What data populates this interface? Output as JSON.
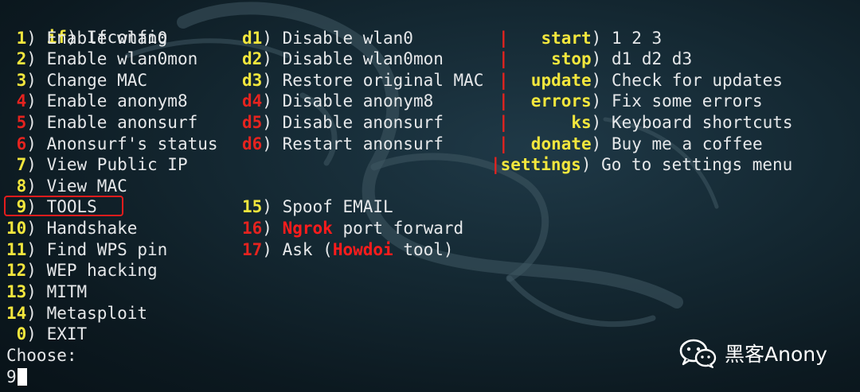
{
  "header": {
    "key": "if",
    "sep": ")",
    "label": "Ifconfig"
  },
  "left_menu": [
    {
      "key": " 1",
      "label": "Enable wlan0",
      "key_color": "yellow"
    },
    {
      "key": " 2",
      "label": "Enable wlan0mon",
      "key_color": "yellow"
    },
    {
      "key": " 3",
      "label": "Change MAC",
      "key_color": "yellow"
    },
    {
      "key": " 4",
      "label": "Enable anonym8",
      "key_color": "red"
    },
    {
      "key": " 5",
      "label": "Enable anonsurf",
      "key_color": "red"
    },
    {
      "key": " 6",
      "label": "Anonsurf's status",
      "key_color": "red"
    },
    {
      "key": " 7",
      "label": "View Public IP",
      "key_color": "yellow"
    },
    {
      "key": " 8",
      "label": "View MAC",
      "key_color": "yellow"
    },
    {
      "key": " 9",
      "label": "TOOLS",
      "key_color": "yellow"
    },
    {
      "key": "10",
      "label": "Handshake",
      "key_color": "yellow"
    },
    {
      "key": "11",
      "label": "Find WPS pin",
      "key_color": "yellow"
    },
    {
      "key": "12",
      "label": "WEP hacking",
      "key_color": "yellow"
    },
    {
      "key": "13",
      "label": "MITM",
      "key_color": "yellow"
    },
    {
      "key": "14",
      "label": "Metasploit",
      "key_color": "yellow"
    },
    {
      "key": " 0",
      "label": "EXIT",
      "key_color": "yellow"
    }
  ],
  "mid_menu": {
    "d1": {
      "key": "d1",
      "label": "Disable wlan0"
    },
    "d2": {
      "key": "d2",
      "label": "Disable wlan0mon"
    },
    "d3": {
      "key": "d3",
      "label": "Restore original MAC"
    },
    "d4": {
      "key": "d4",
      "label": "Disable anonym8"
    },
    "d5": {
      "key": "d5",
      "label": "Disable anonsurf"
    },
    "d6": {
      "key": "d6",
      "label": "Restart anonsurf"
    },
    "i15": {
      "key": "15",
      "label": "Spoof EMAIL"
    },
    "i16": {
      "key": "16",
      "highlight": "Ngrok",
      "label": "port forward"
    },
    "i17": {
      "key": "17",
      "label_pre": "Ask (",
      "highlight": "Howdoi",
      "label_post": "tool)"
    }
  },
  "right_menu": [
    {
      "bar": "|",
      "key": "start",
      "label": "1 2 3"
    },
    {
      "bar": "|",
      "key": "stop",
      "label": "d1 d2 d3"
    },
    {
      "bar": "|",
      "key": "update",
      "label": "Check for updates"
    },
    {
      "bar": "|",
      "key": "errors",
      "label": "Fix some errors"
    },
    {
      "bar": "|",
      "key": "ks",
      "label": "Keyboard shortcuts"
    },
    {
      "bar": "|",
      "key": "donate",
      "label": "Buy me a coffee"
    },
    {
      "bar": "|",
      "key": "settings",
      "label": "Go to settings menu"
    }
  ],
  "prompt": {
    "label": "Choose:",
    "input_value": "9"
  },
  "watermark": {
    "text": "黑客Anony",
    "icon": "wechat-icon"
  },
  "colors": {
    "key_yellow": "#f2e63d",
    "key_red": "#e5231f",
    "text": "#e6e8ea",
    "highlight_box": "#e51c1c",
    "background": "#142832"
  }
}
